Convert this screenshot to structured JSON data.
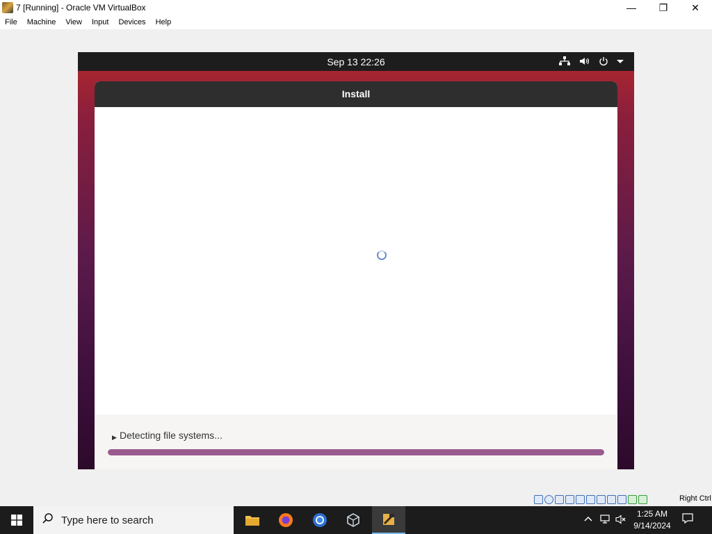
{
  "window": {
    "title": "7 [Running] - Oracle VM VirtualBox",
    "controls": {
      "minimize": "—",
      "restore": "❐",
      "close": "✕"
    }
  },
  "menu": [
    "File",
    "Machine",
    "View",
    "Input",
    "Devices",
    "Help"
  ],
  "vm_screen": {
    "topbar": {
      "clock": "Sep 13  22:26",
      "icons": [
        "network-icon",
        "volume-icon",
        "power-icon",
        "dropdown-arrow-icon"
      ]
    },
    "installer": {
      "title": "Install",
      "status": "Detecting file systems...",
      "progress": 1.0
    }
  },
  "vbox_status": {
    "icons": [
      "hard-disk-icon",
      "optical-drive-icon",
      "audio-icon",
      "network-icon",
      "usb-icon",
      "shared-folders-icon",
      "display-icon",
      "video-capture-icon",
      "cpu-icon",
      "mouse-integration-icon",
      "guest-additions-icon"
    ],
    "host_key": "Right Ctrl"
  },
  "taskbar": {
    "search_placeholder": "Type here to search",
    "apps": [
      "file-explorer-icon",
      "firefox-icon",
      "chrome-icon",
      "virtualbox-manager-icon",
      "virtualbox-vm-icon"
    ],
    "time": "1:25 AM",
    "date": "9/14/2024"
  }
}
